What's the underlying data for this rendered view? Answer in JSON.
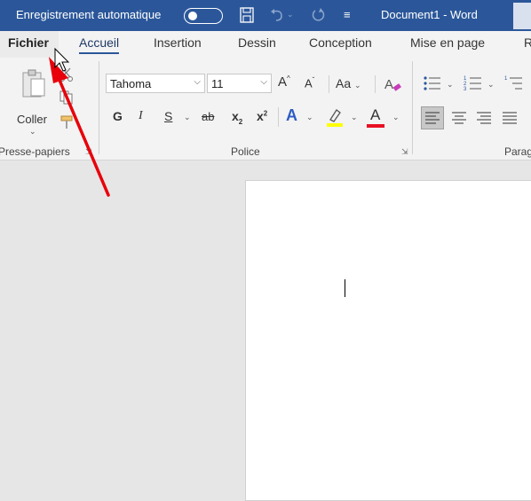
{
  "titlebar": {
    "autosave_label": "Enregistrement automatique",
    "doc_title": "Document1  -  Word",
    "bg_color": "#2b579a"
  },
  "tabs": {
    "file": "Fichier",
    "home": "Accueil",
    "insert": "Insertion",
    "draw": "Dessin",
    "design": "Conception",
    "layout": "Mise en page",
    "overflow": "R"
  },
  "clipboard": {
    "paste_label": "Coller",
    "group_label": "Presse-papiers"
  },
  "font": {
    "font_name": "Tahoma",
    "font_size": "11",
    "bold": "G",
    "italic": "I",
    "underline": "S",
    "strikethrough": "ab",
    "subscript": "x",
    "subscript_mark": "2",
    "superscript": "x",
    "superscript_mark": "2",
    "grow": "A",
    "shrink": "A",
    "case": "Aa",
    "text_effect": "A",
    "highlight_color": "#ffff00",
    "font_color": "#e81123",
    "group_label": "Police"
  },
  "paragraph": {
    "group_label": "Parag"
  },
  "annotation": {
    "arrow_color": "#e8000b"
  }
}
